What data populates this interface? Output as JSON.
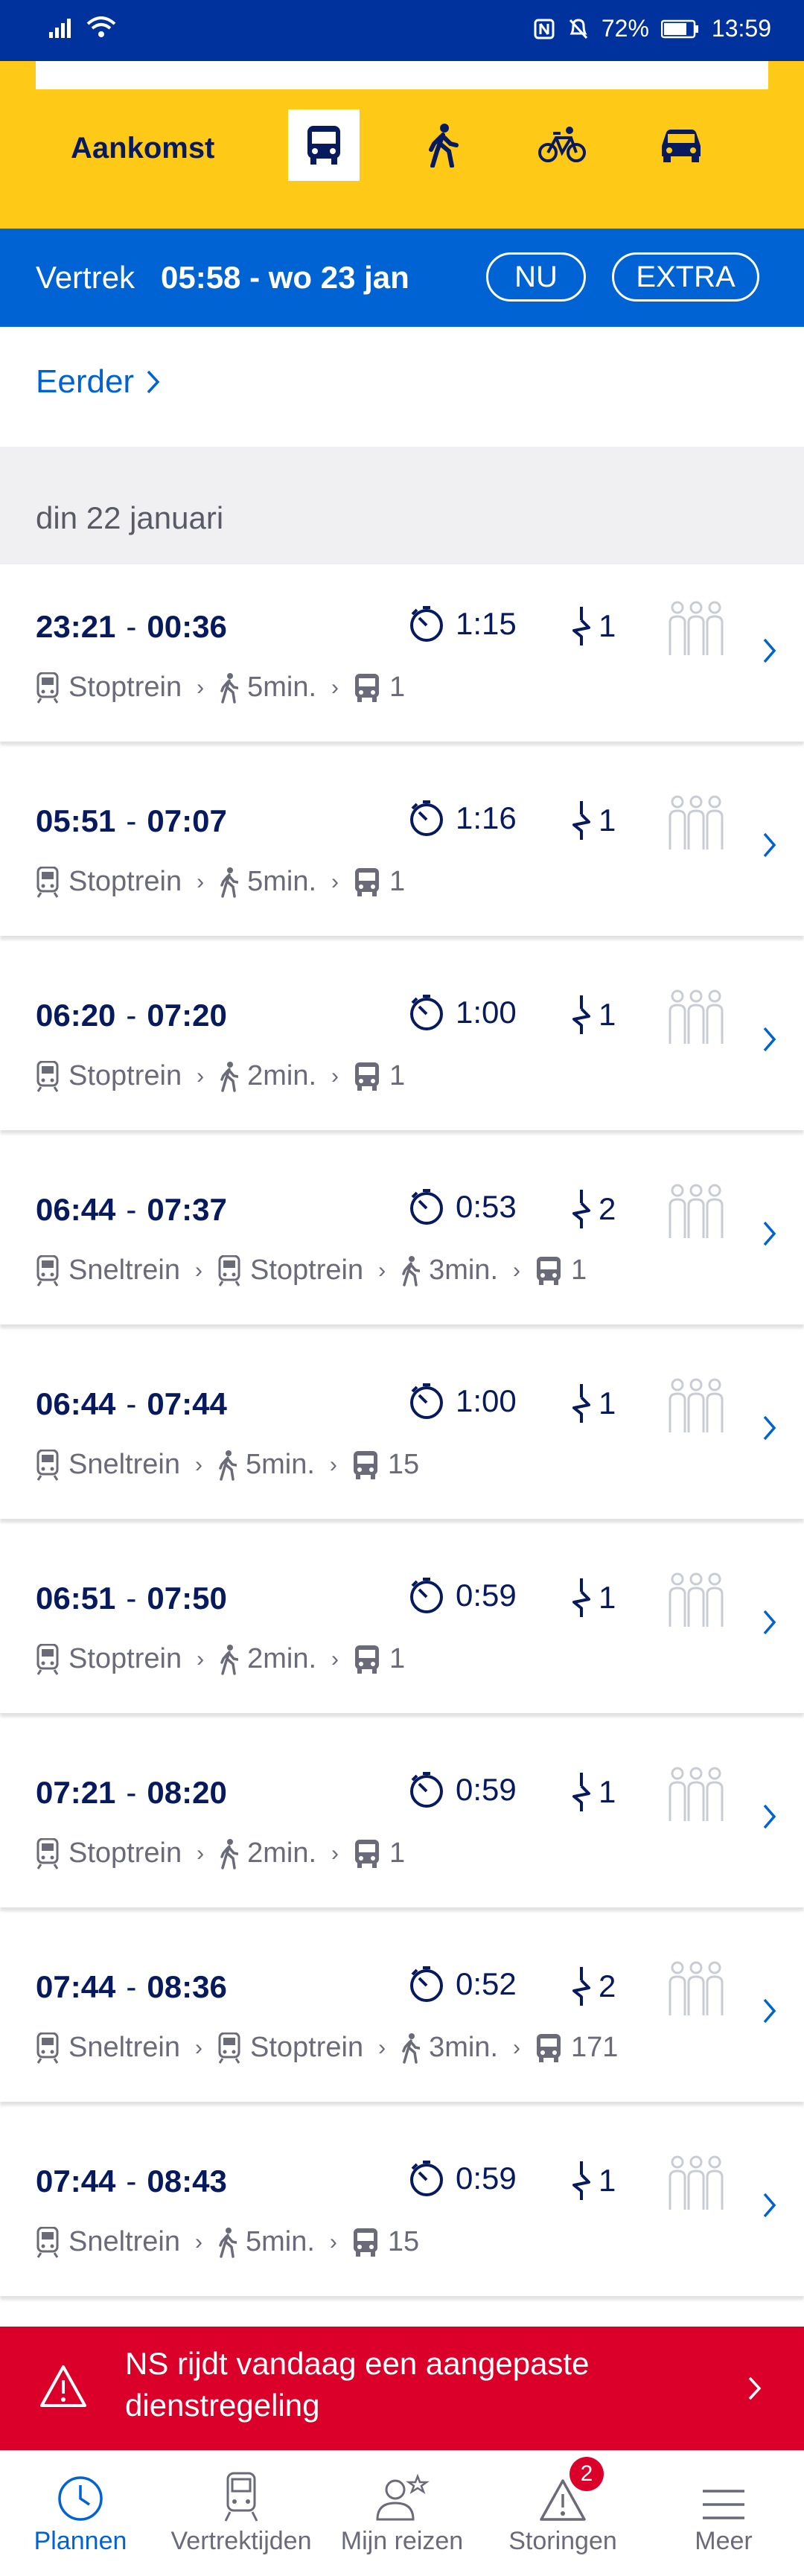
{
  "status_bar": {
    "battery": "72%",
    "time": "13:59"
  },
  "mode_selector": {
    "arrival_label": "Aankomst",
    "modes": [
      "bus-icon",
      "walk-icon",
      "bike-icon",
      "car-icon"
    ],
    "selected": "bus-icon"
  },
  "departure": {
    "label": "Vertrek",
    "value": "05:58 - wo 23 jan",
    "now_button": "NU",
    "extra_button": "EXTRA"
  },
  "earlier_link": "Eerder",
  "day_header": "din 22 januari",
  "trips": [
    {
      "dep": "23:21",
      "arr": "00:36",
      "duration": "1:15",
      "transfers": "1",
      "legs": [
        {
          "type": "train",
          "label": "Stoptrein"
        },
        {
          "type": "walk",
          "label": "5min."
        },
        {
          "type": "bus",
          "label": "1"
        }
      ]
    },
    {
      "dep": "05:51",
      "arr": "07:07",
      "duration": "1:16",
      "transfers": "1",
      "legs": [
        {
          "type": "train",
          "label": "Stoptrein"
        },
        {
          "type": "walk",
          "label": "5min."
        },
        {
          "type": "bus",
          "label": "1"
        }
      ]
    },
    {
      "dep": "06:20",
      "arr": "07:20",
      "duration": "1:00",
      "transfers": "1",
      "legs": [
        {
          "type": "train",
          "label": "Stoptrein"
        },
        {
          "type": "walk",
          "label": "2min."
        },
        {
          "type": "bus",
          "label": "1"
        }
      ]
    },
    {
      "dep": "06:44",
      "arr": "07:37",
      "duration": "0:53",
      "transfers": "2",
      "legs": [
        {
          "type": "train",
          "label": "Sneltrein"
        },
        {
          "type": "train",
          "label": "Stoptrein"
        },
        {
          "type": "walk",
          "label": "3min."
        },
        {
          "type": "bus",
          "label": "1"
        }
      ]
    },
    {
      "dep": "06:44",
      "arr": "07:44",
      "duration": "1:00",
      "transfers": "1",
      "legs": [
        {
          "type": "train",
          "label": "Sneltrein"
        },
        {
          "type": "walk",
          "label": "5min."
        },
        {
          "type": "bus",
          "label": "15"
        }
      ]
    },
    {
      "dep": "06:51",
      "arr": "07:50",
      "duration": "0:59",
      "transfers": "1",
      "legs": [
        {
          "type": "train",
          "label": "Stoptrein"
        },
        {
          "type": "walk",
          "label": "2min."
        },
        {
          "type": "bus",
          "label": "1"
        }
      ]
    },
    {
      "dep": "07:21",
      "arr": "08:20",
      "duration": "0:59",
      "transfers": "1",
      "legs": [
        {
          "type": "train",
          "label": "Stoptrein"
        },
        {
          "type": "walk",
          "label": "2min."
        },
        {
          "type": "bus",
          "label": "1"
        }
      ]
    },
    {
      "dep": "07:44",
      "arr": "08:36",
      "duration": "0:52",
      "transfers": "2",
      "legs": [
        {
          "type": "train",
          "label": "Sneltrein"
        },
        {
          "type": "train",
          "label": "Stoptrein"
        },
        {
          "type": "walk",
          "label": "3min."
        },
        {
          "type": "bus",
          "label": "171"
        }
      ]
    },
    {
      "dep": "07:44",
      "arr": "08:43",
      "duration": "0:59",
      "transfers": "1",
      "legs": [
        {
          "type": "train",
          "label": "Sneltrein"
        },
        {
          "type": "walk",
          "label": "5min."
        },
        {
          "type": "bus",
          "label": "15"
        }
      ]
    }
  ],
  "alert": {
    "text": "NS rijdt vandaag een aangepaste dienstregeling"
  },
  "tabs": [
    {
      "label": "Plannen",
      "icon": "clock-icon",
      "active": true
    },
    {
      "label": "Vertrektijden",
      "icon": "train-icon",
      "active": false
    },
    {
      "label": "Mijn reizen",
      "icon": "profile-star-icon",
      "active": false
    },
    {
      "label": "Storingen",
      "icon": "warning-icon",
      "active": false,
      "badge": "2"
    },
    {
      "label": "Meer",
      "icon": "menu-icon",
      "active": false
    }
  ],
  "colors": {
    "ns_yellow": "#ffc917",
    "ns_blue": "#0063d3",
    "ns_dark_blue": "#071a5e",
    "status_blue": "#00329e",
    "alert_red": "#db0029"
  }
}
